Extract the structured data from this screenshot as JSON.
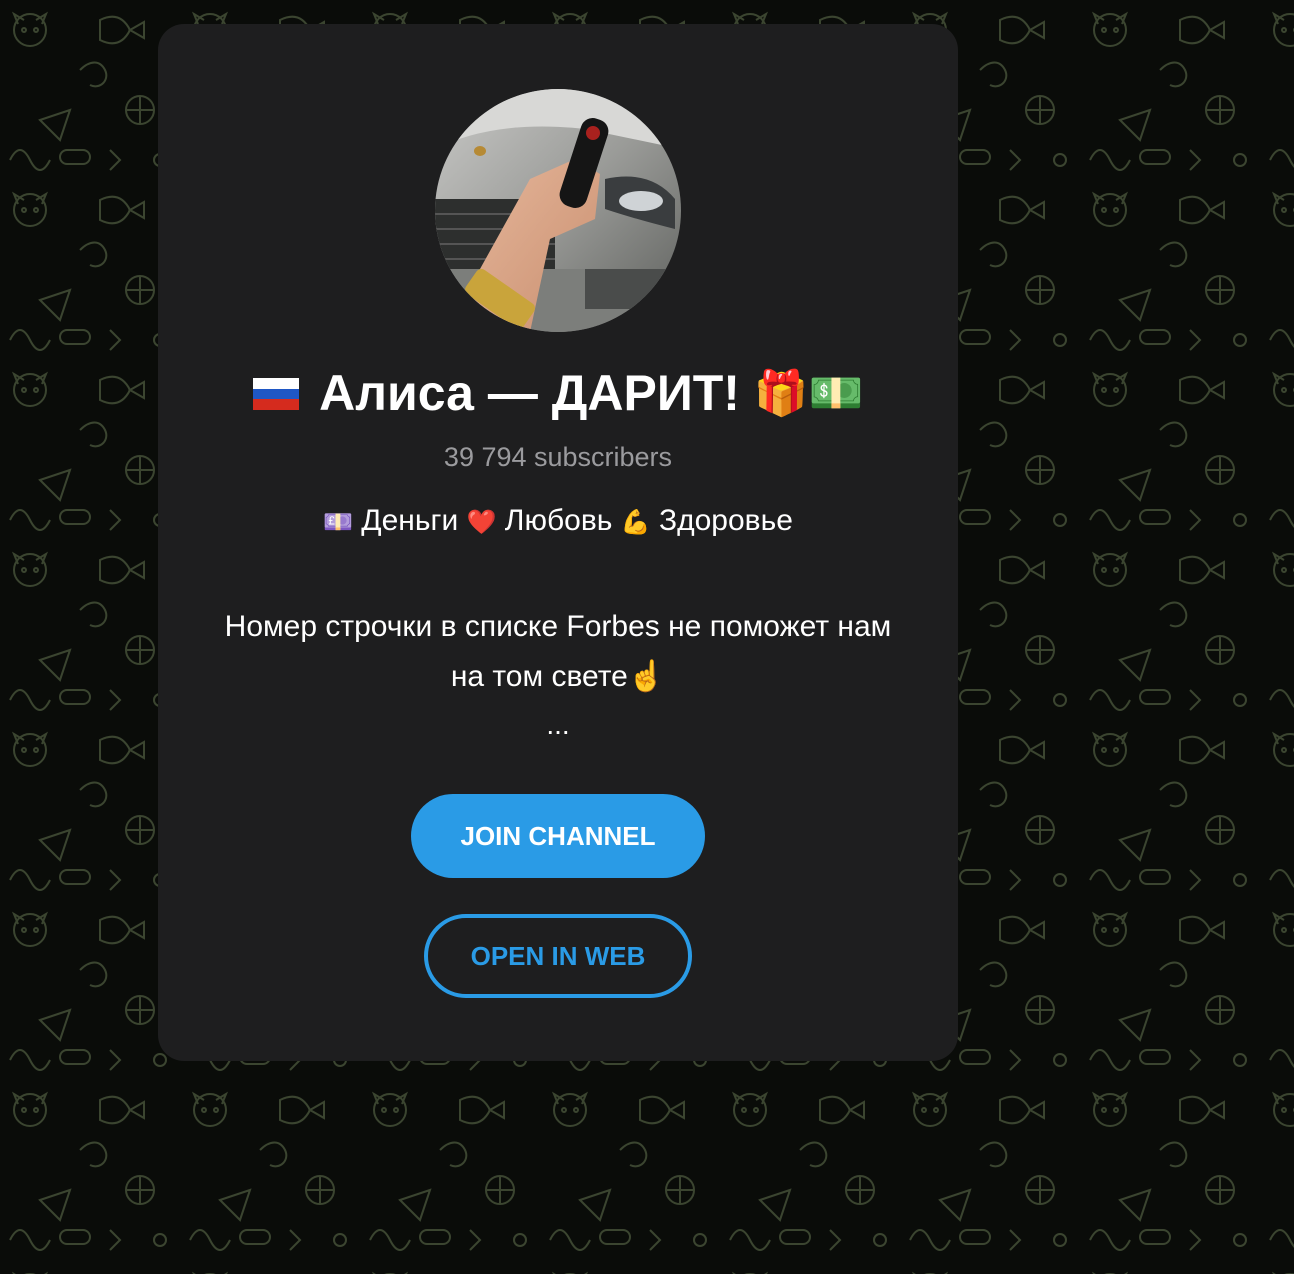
{
  "channel": {
    "flag_icon": "russia-flag",
    "title": "Алиса — ДАРИТ!",
    "title_emoji": "🎁💵",
    "subscribers": "39 794 subscribers",
    "tagline": {
      "money_emoji": "💷",
      "money": "Деньги",
      "love_emoji": "❤️",
      "love": "Любовь",
      "health_emoji": "💪",
      "health": "Здоровье"
    },
    "description_line1": "Номер строчки в списке Forbes не поможет нам",
    "description_line2": "на том свете☝️",
    "ellipsis": "..."
  },
  "buttons": {
    "join": "JOIN CHANNEL",
    "web": "OPEN IN WEB"
  },
  "colors": {
    "accent": "#2a9be6",
    "card": "#1e1e1f",
    "background": "#0a0c09",
    "muted_text": "#9b9b9e"
  }
}
